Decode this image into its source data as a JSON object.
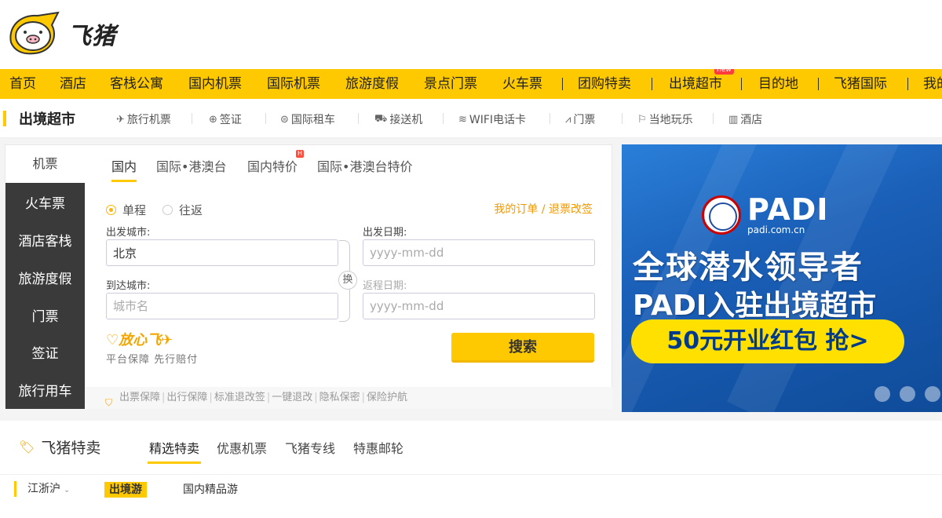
{
  "brand": {
    "name": "飞猪"
  },
  "main_nav": [
    {
      "label": "首页"
    },
    {
      "label": "酒店"
    },
    {
      "label": "客栈公寓"
    },
    {
      "label": "国内机票"
    },
    {
      "label": "国际机票"
    },
    {
      "label": "旅游度假"
    },
    {
      "label": "景点门票"
    },
    {
      "label": "火车票"
    },
    {
      "label": "团购特卖"
    },
    {
      "label": "出境超市",
      "badge": "new"
    },
    {
      "label": "目的地"
    },
    {
      "label": "飞猪国际"
    },
    {
      "label": "我的"
    }
  ],
  "sub_nav": {
    "title": "出境超市",
    "items": [
      {
        "label": "旅行机票",
        "icon": "plane-icon"
      },
      {
        "label": "签证",
        "icon": "globe-icon"
      },
      {
        "label": "国际租车",
        "icon": "car-icon"
      },
      {
        "label": "接送机",
        "icon": "shuttle-icon"
      },
      {
        "label": "WIFI电话卡",
        "icon": "wifi-icon"
      },
      {
        "label": "门票",
        "icon": "ticket-icon"
      },
      {
        "label": "当地玩乐",
        "icon": "flag-icon"
      },
      {
        "label": "酒店",
        "icon": "hotel-icon"
      }
    ]
  },
  "booking": {
    "side_title": "机票",
    "side_items": [
      {
        "label": "火车票"
      },
      {
        "label": "酒店客栈"
      },
      {
        "label": "旅游度假"
      },
      {
        "label": "门票"
      },
      {
        "label": "签证"
      },
      {
        "label": "旅行用车"
      }
    ],
    "tabs": [
      {
        "label": "国内",
        "active": true
      },
      {
        "label": "国际•港澳台"
      },
      {
        "label": "国内特价",
        "badge": "H"
      },
      {
        "label": "国际•港澳台特价"
      }
    ],
    "trip_types": [
      {
        "label": "单程",
        "selected": true
      },
      {
        "label": "往返",
        "selected": false
      }
    ],
    "links": {
      "orders": "我的订单",
      "sep": " / ",
      "refund": "退票改签"
    },
    "from_label": "出发城市:",
    "from_value": "北京",
    "to_label": "到达城市:",
    "to_placeholder": "城市名",
    "depart_label": "出发日期:",
    "depart_placeholder": "yyyy-mm-dd",
    "return_label": "返程日期:",
    "return_placeholder": "yyyy-mm-dd",
    "swap_label": "换",
    "assurance_brand": "放心飞",
    "assurance_sub": "平台保障 先行赔付",
    "search_label": "搜索",
    "guarantees": [
      "出票保障",
      "出行保障",
      "标准退改签",
      "一键退改",
      "隐私保密",
      "保险护航"
    ]
  },
  "banner": {
    "logo_text": "PADI",
    "logo_url_text": "padi.com.cn",
    "headline": "全球潜水领导者",
    "subline": "PADI入驻出境超市",
    "cta": "50元开业红包 抢>",
    "slide_count": 3,
    "colors": {
      "bg": "#1a5fb8",
      "cta": "#ffe000"
    }
  },
  "deals": {
    "title": "飞猪特卖",
    "tabs": [
      {
        "label": "精选特卖",
        "active": true
      },
      {
        "label": "优惠机票"
      },
      {
        "label": "飞猪专线"
      },
      {
        "label": "特惠邮轮"
      }
    ],
    "region": "江浙沪",
    "chips": [
      {
        "label": "出境游",
        "active": true
      },
      {
        "label": "国内精品游"
      }
    ]
  },
  "colors": {
    "accent": "#ffc900",
    "link": "#f39800",
    "sidebar": "#3a3a3a"
  }
}
